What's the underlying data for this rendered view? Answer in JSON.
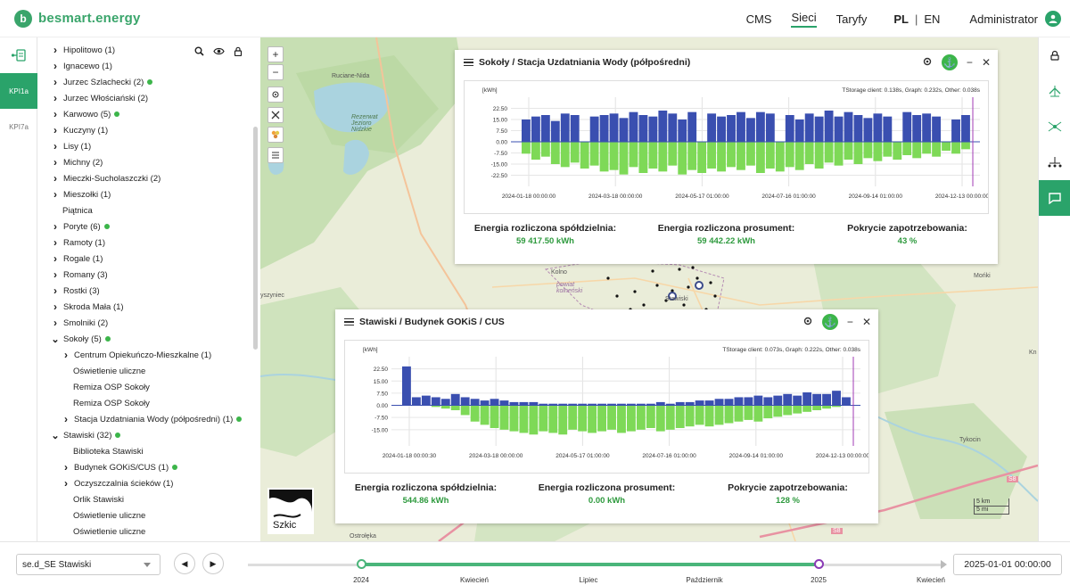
{
  "header": {
    "logo_glyph": "b",
    "brand": "besmart.energy",
    "nav": [
      "CMS",
      "Sieci",
      "Taryfy"
    ],
    "active_nav": "Sieci",
    "lang_pl": "PL",
    "lang_sep": "|",
    "lang_en": "EN",
    "user": "Administrator"
  },
  "rail": {
    "items": [
      {
        "label": "",
        "icon": "network-icon"
      },
      {
        "label": "KPI1a"
      },
      {
        "label": "KPI7a"
      }
    ]
  },
  "tree": {
    "rows": [
      {
        "label": "Hipolitowo (1)",
        "level": 0,
        "chev": "right",
        "dot": false
      },
      {
        "label": "Ignacewo (1)",
        "level": 0,
        "chev": "right",
        "dot": false
      },
      {
        "label": "Jurzec Szlachecki (2)",
        "level": 0,
        "chev": "right",
        "dot": true
      },
      {
        "label": "Jurzec Włościański (2)",
        "level": 0,
        "chev": "right",
        "dot": false
      },
      {
        "label": "Karwowo (5)",
        "level": 0,
        "chev": "right",
        "dot": true
      },
      {
        "label": "Kuczyny (1)",
        "level": 0,
        "chev": "right",
        "dot": false
      },
      {
        "label": "Lisy (1)",
        "level": 0,
        "chev": "right",
        "dot": false
      },
      {
        "label": "Michny (2)",
        "level": 0,
        "chev": "right",
        "dot": false
      },
      {
        "label": "Mieczki-Sucholaszczki (2)",
        "level": 0,
        "chev": "right",
        "dot": false
      },
      {
        "label": "Mieszołki (1)",
        "level": 0,
        "chev": "right",
        "dot": false
      },
      {
        "label": "Piątnica",
        "level": 0,
        "chev": "none",
        "dot": false
      },
      {
        "label": "Poryte (6)",
        "level": 0,
        "chev": "right",
        "dot": true
      },
      {
        "label": "Ramoty (1)",
        "level": 0,
        "chev": "right",
        "dot": false
      },
      {
        "label": "Rogale (1)",
        "level": 0,
        "chev": "right",
        "dot": false
      },
      {
        "label": "Romany (3)",
        "level": 0,
        "chev": "right",
        "dot": false
      },
      {
        "label": "Rostki (3)",
        "level": 0,
        "chev": "right",
        "dot": false
      },
      {
        "label": "Skroda Mała (1)",
        "level": 0,
        "chev": "right",
        "dot": false
      },
      {
        "label": "Smolniki (2)",
        "level": 0,
        "chev": "right",
        "dot": false
      },
      {
        "label": "Sokoły (5)",
        "level": 0,
        "chev": "down",
        "dot": true
      },
      {
        "label": "Centrum Opiekuńczo-Mieszkalne (1)",
        "level": 1,
        "chev": "right",
        "dot": false
      },
      {
        "label": "Oświetlenie uliczne",
        "level": 1,
        "chev": "none",
        "dot": false
      },
      {
        "label": "Remiza OSP Sokoły",
        "level": 1,
        "chev": "none",
        "dot": false
      },
      {
        "label": "Remiza OSP Sokoły",
        "level": 1,
        "chev": "none",
        "dot": false
      },
      {
        "label": "Stacja Uzdatniania Wody (półpośredni) (1)",
        "level": 1,
        "chev": "right",
        "dot": true
      },
      {
        "label": "Stawiski (32)",
        "level": 0,
        "chev": "down",
        "dot": true
      },
      {
        "label": "Biblioteka Stawiski",
        "level": 1,
        "chev": "none",
        "dot": false
      },
      {
        "label": "Budynek GOKiS/CUS (1)",
        "level": 1,
        "chev": "right",
        "dot": true
      },
      {
        "label": "Oczyszczalnia ścieków (1)",
        "level": 1,
        "chev": "right",
        "dot": false
      },
      {
        "label": "Orlik Stawiski",
        "level": 1,
        "chev": "none",
        "dot": false
      },
      {
        "label": "Oświetlenie uliczne",
        "level": 1,
        "chev": "none",
        "dot": false
      },
      {
        "label": "Oświetlenie uliczne",
        "level": 1,
        "chev": "none",
        "dot": false
      }
    ]
  },
  "map": {
    "labels": {
      "ruciane": "Ruciane-Nida",
      "rezerwat": "Rezerwat Jezioro Nidzkie",
      "kolno": "Kolno",
      "powiat": "powiat kolneński",
      "myszyniec": "yszyniec",
      "monki": "Mońki",
      "tykocin": "Tykocin",
      "ostroleka": "Ostrołęka",
      "stawiski_lbl": "Stawiski",
      "kn": "Kn"
    },
    "minimap_label": "Szkic",
    "scale_km": "5 km",
    "scale_mi": "5 mi",
    "road_s8_a": "S8",
    "road_s8_b": "S8"
  },
  "panels": [
    {
      "title": "Sokoły / Stacja Uzdatniania Wody (półpośredni)",
      "stats": [
        {
          "label": "Energia rozliczona spółdzielnia:",
          "value": "59 417.50 kWh"
        },
        {
          "label": "Energia rozliczona prosument:",
          "value": "59 442.22 kWh"
        },
        {
          "label": "Pokrycie zapotrzebowania:",
          "value": "43 %"
        }
      ]
    },
    {
      "title": "Stawiski / Budynek GOKiS / CUS",
      "stats": [
        {
          "label": "Energia rozliczona spółdzielnia:",
          "value": "544.86 kWh"
        },
        {
          "label": "Energia rozliczona prosument:",
          "value": "0.00 kWh"
        },
        {
          "label": "Pokrycie zapotrzebowania:",
          "value": "128 %"
        }
      ]
    }
  ],
  "chart_data": [
    {
      "type": "bar",
      "ylabel": "[kWh]",
      "annotation": "TStorage client: 0.138s, Graph: 0.232s, Other: 0.038s",
      "ylim": [
        -30,
        30
      ],
      "yticks": [
        22.5,
        15.0,
        7.5,
        0.0,
        -7.5,
        -15.0,
        -22.5
      ],
      "xticks": [
        "2024-01-18 00:00:00",
        "2024-03-18 00:00:00",
        "2024-05-17 01:00:00",
        "2024-07-16 01:00:00",
        "2024-09-14 01:00:00",
        "2024-12-13 00:00:00"
      ],
      "series": [
        {
          "name": "",
          "color": "#3a4fb0",
          "values": [
            15,
            17,
            18,
            14,
            19,
            18,
            0,
            17,
            18,
            19,
            16,
            20,
            18,
            17,
            21,
            19,
            15,
            20,
            0,
            19,
            17,
            18,
            20,
            16,
            20,
            19,
            0,
            18,
            15,
            19,
            17,
            21,
            17,
            20,
            18,
            16,
            19,
            17,
            0,
            20,
            18,
            19,
            17,
            0,
            15,
            18
          ]
        },
        {
          "name": "",
          "color": "#7ed957",
          "values": [
            -8,
            -12,
            -10,
            -15,
            -17,
            -14,
            -18,
            -16,
            -20,
            -19,
            -22,
            -17,
            -21,
            -18,
            -20,
            -16,
            -22,
            -19,
            -21,
            -18,
            -20,
            -17,
            -19,
            -16,
            -21,
            -18,
            -20,
            -17,
            -19,
            -15,
            -18,
            -14,
            -16,
            -12,
            -15,
            -11,
            -13,
            -10,
            -12,
            -9,
            -11,
            -8,
            -10,
            -6,
            -8,
            -5
          ]
        }
      ]
    },
    {
      "type": "bar",
      "ylabel": "[kWh]",
      "annotation": "TStorage client: 0.073s, Graph: 0.222s, Other: 0.038s",
      "ylim": [
        -25,
        30
      ],
      "yticks": [
        22.5,
        15.0,
        7.5,
        0.0,
        -7.5,
        -15.0
      ],
      "xticks": [
        "2024-01-18 00:00:30",
        "2024-03-18 00:00:00",
        "2024-05-17 01:00:00",
        "2024-07-16 01:00:00",
        "2024-09-14 01:00:00",
        "2024-12-13 00:00:00"
      ],
      "series": [
        {
          "name": "",
          "color": "#3a4fb0",
          "values": [
            24,
            5,
            6,
            5,
            4,
            7,
            5,
            4,
            3,
            4,
            3,
            2,
            2,
            2,
            1,
            1,
            1,
            1,
            1,
            1,
            1,
            1,
            1,
            1,
            1,
            1,
            2,
            1,
            2,
            2,
            3,
            3,
            4,
            4,
            5,
            5,
            6,
            5,
            6,
            7,
            6,
            8,
            7,
            7,
            9,
            5
          ]
        },
        {
          "name": "",
          "color": "#7ed957",
          "values": [
            0,
            0,
            0,
            -1,
            -2,
            -3,
            -6,
            -10,
            -12,
            -14,
            -15,
            -16,
            -17,
            -18,
            -16,
            -17,
            -18,
            -15,
            -16,
            -17,
            -16,
            -15,
            -17,
            -16,
            -15,
            -14,
            -16,
            -15,
            -14,
            -13,
            -12,
            -13,
            -12,
            -11,
            -10,
            -9,
            -10,
            -8,
            -7,
            -6,
            -5,
            -4,
            -3,
            -2,
            -1,
            0
          ]
        }
      ]
    }
  ],
  "bottom": {
    "select_value": "se.d_SE Stawiski",
    "prev_glyph": "◀",
    "next_glyph": "▶",
    "ticks": [
      "2024",
      "Kwiecień",
      "Lipiec",
      "Październik",
      "2025",
      "Kwiecień"
    ],
    "date": "2025-01-01 00:00:00"
  }
}
